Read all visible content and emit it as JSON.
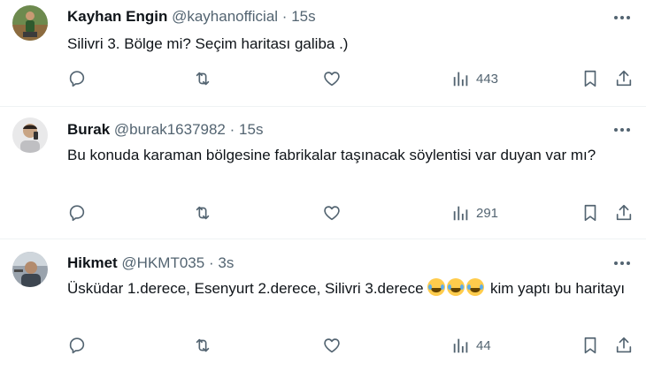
{
  "tweets": [
    {
      "name": "Kayhan Engin",
      "handle": "@kayhanofficial",
      "dot": "·",
      "time": "15s",
      "text": "Silivri 3. Bölge mi? Seçim haritası galiba .)",
      "views": "443"
    },
    {
      "name": "Burak",
      "handle": "@burak1637982",
      "dot": "·",
      "time": "15s",
      "text": "Bu konuda karaman bölgesine fabrikalar taşınacak söylentisi var duyan var mı?",
      "views": "291"
    },
    {
      "name": "Hikmet",
      "handle": "@HKMT035",
      "dot": "·",
      "time": "3s",
      "text_before_emoji": "Üsküdar 1.derece, Esenyurt 2.derece, Silivri 3.derece ",
      "text_after_emoji": " kim yaptı bu haritayı",
      "views": "44"
    }
  ],
  "icons": {
    "reply": "reply-icon",
    "retweet": "retweet-icon",
    "like": "heart-icon",
    "views": "views-chart-icon",
    "bookmark": "bookmark-icon",
    "share": "share-icon",
    "more": "more-dots-icon",
    "emoji": "face-with-tears-of-joy-emoji"
  },
  "colors": {
    "text": "#0f1419",
    "secondary": "#536471",
    "divider": "#eff3f4"
  }
}
